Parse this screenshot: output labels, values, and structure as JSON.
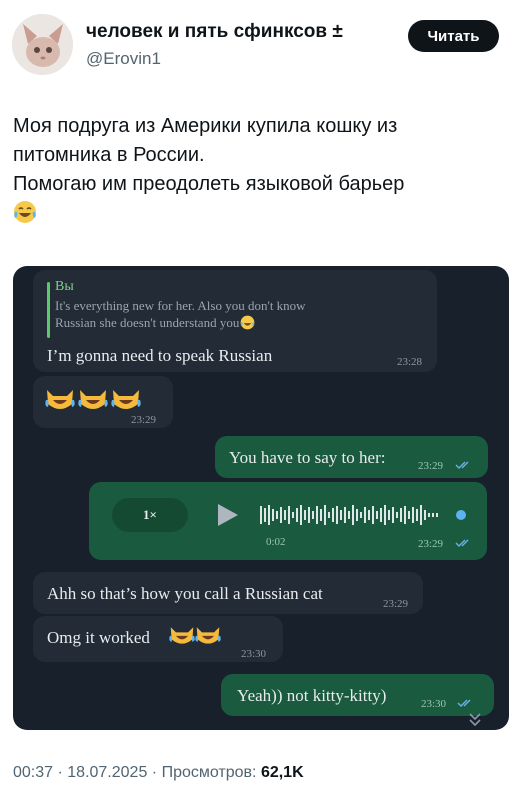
{
  "header": {
    "display_name": "человек и пять сфинксов ±",
    "handle": "@Erovin1",
    "follow_label": "Читать"
  },
  "tweet": {
    "lines": [
      "Моя подруга из Америки купила кошку из",
      "питомника в России.",
      "Помогаю им преодолеть языковой барьер"
    ],
    "emoji": "face-with-tears-of-joy"
  },
  "chat": {
    "messages": [
      {
        "side": "in",
        "reply_author": "Вы",
        "reply_text_1": "It's everything new for her. Also you don't know",
        "reply_text_2": "Russian she doesn't understand you",
        "text": "I’m gonna need to speak Russian",
        "time": "23:28"
      },
      {
        "side": "in",
        "text": "",
        "emojis": "three crying-laughing cat faces",
        "time": "23:29"
      },
      {
        "side": "out",
        "text": "You have to say to her:",
        "time": "23:29"
      },
      {
        "side": "out",
        "type": "voice",
        "speed": "1×",
        "duration": "0:02",
        "time": "23:29"
      },
      {
        "side": "in",
        "text": "Ahh so that’s how you call a Russian cat",
        "time": "23:29"
      },
      {
        "side": "in",
        "text": "Omg it worked",
        "time": "23:30"
      },
      {
        "side": "out",
        "text": "Yeah)) not kitty-kitty)",
        "time": "23:30"
      }
    ]
  },
  "footer": {
    "time": "00:37",
    "date": "18.07.2025",
    "views_label": "Просмотров:",
    "views_count": "62,1K",
    "separator": " · "
  },
  "colors": {
    "chat_bg": "#17202b",
    "incoming": "#222b36",
    "outgoing": "#1a5a3e",
    "accent_green": "#5cc96e",
    "tick_blue": "#6cb2e8"
  }
}
